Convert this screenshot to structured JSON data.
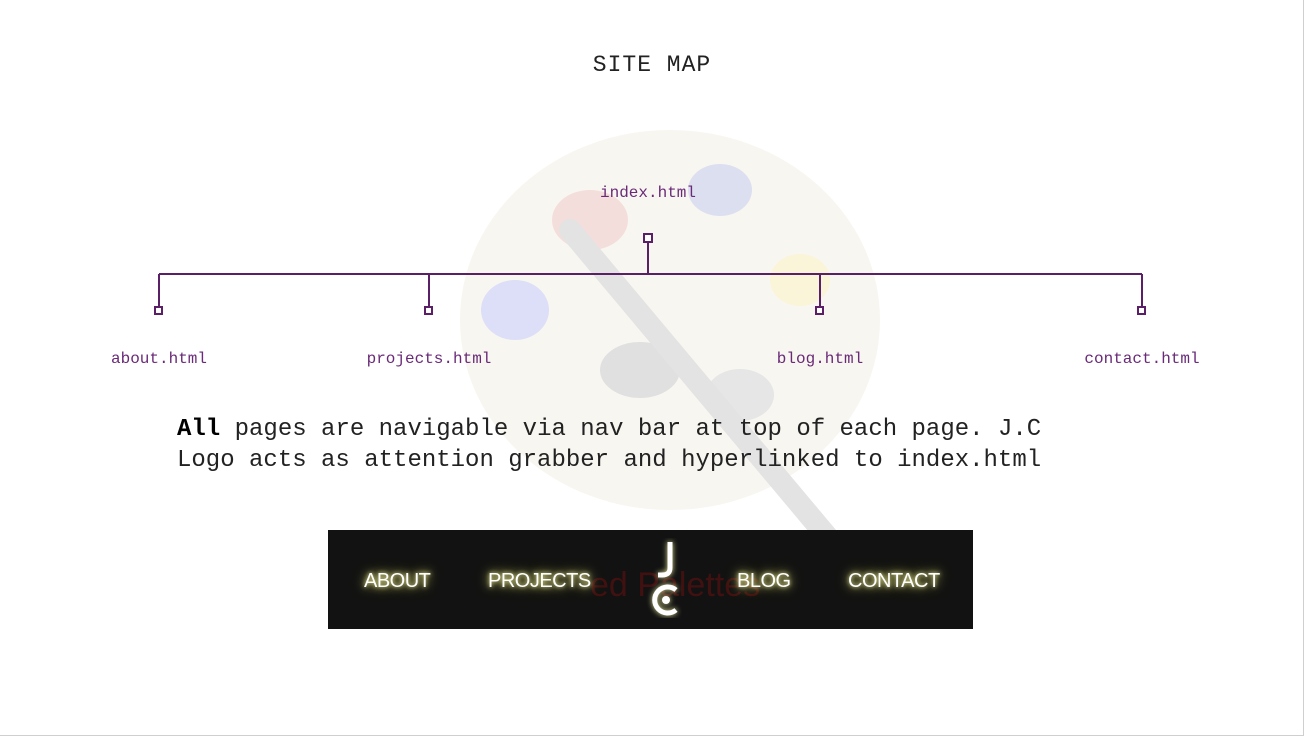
{
  "title": "SITE MAP",
  "tree": {
    "root": "index.html",
    "children": [
      "about.html",
      "projects.html",
      "blog.html",
      "contact.html"
    ]
  },
  "description": {
    "bold": "All",
    "line1_rest": " pages are navigable via nav bar at top of each page. J.C",
    "line2": "Logo acts as attention grabber and hyperlinked to index.html"
  },
  "navbar": {
    "items": [
      "ABOUT",
      "PROJECTS",
      "BLOG",
      "CONTACT"
    ],
    "logo_text": "JC",
    "ghost_text": "ed Palettes"
  },
  "colors": {
    "tree_line": "#5a1f66",
    "tree_label": "#6a2a78",
    "nav_bg": "#121212",
    "nav_glow": "#e7e79a"
  },
  "icons": {
    "watermark": "paint-palette-icon",
    "logo": "jc-logo-icon"
  }
}
